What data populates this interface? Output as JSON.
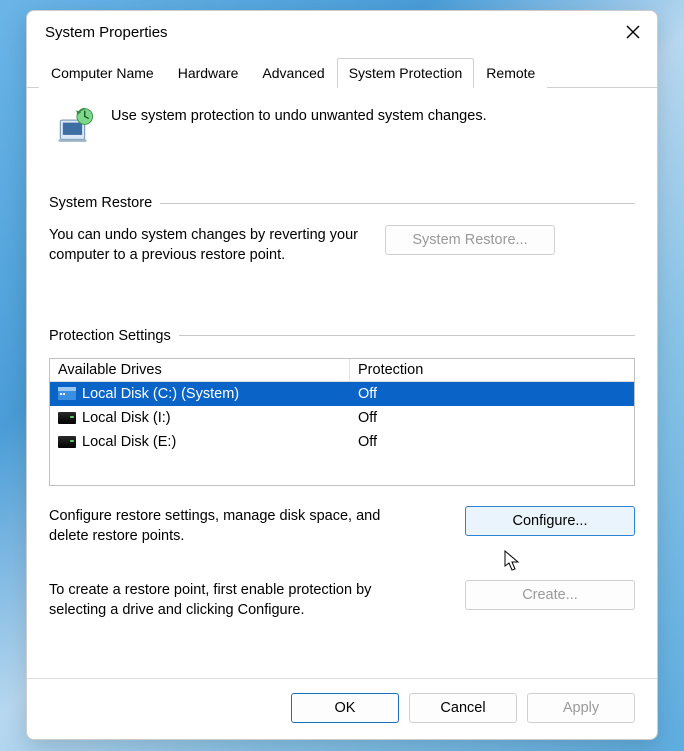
{
  "title": "System Properties",
  "tabs": [
    {
      "label": "Computer Name",
      "active": false
    },
    {
      "label": "Hardware",
      "active": false
    },
    {
      "label": "Advanced",
      "active": false
    },
    {
      "label": "System Protection",
      "active": true
    },
    {
      "label": "Remote",
      "active": false
    }
  ],
  "intro": "Use system protection to undo unwanted system changes.",
  "restore_group": {
    "label": "System Restore",
    "text": "You can undo system changes by reverting your computer to a previous restore point.",
    "button": "System Restore..."
  },
  "protection_group": {
    "label": "Protection Settings",
    "header_drive": "Available Drives",
    "header_prot": "Protection",
    "drives": [
      {
        "name": "Local Disk (C:) (System)",
        "protection": "Off",
        "icon": "blue",
        "selected": true
      },
      {
        "name": "Local Disk (I:)",
        "protection": "Off",
        "icon": "dark",
        "selected": false
      },
      {
        "name": "Local Disk (E:)",
        "protection": "Off",
        "icon": "dark",
        "selected": false
      }
    ],
    "configure_text": "Configure restore settings, manage disk space, and delete restore points.",
    "configure_button": "Configure...",
    "create_text": "To create a restore point, first enable protection by selecting a drive and clicking Configure.",
    "create_button": "Create..."
  },
  "footer": {
    "ok": "OK",
    "cancel": "Cancel",
    "apply": "Apply"
  }
}
